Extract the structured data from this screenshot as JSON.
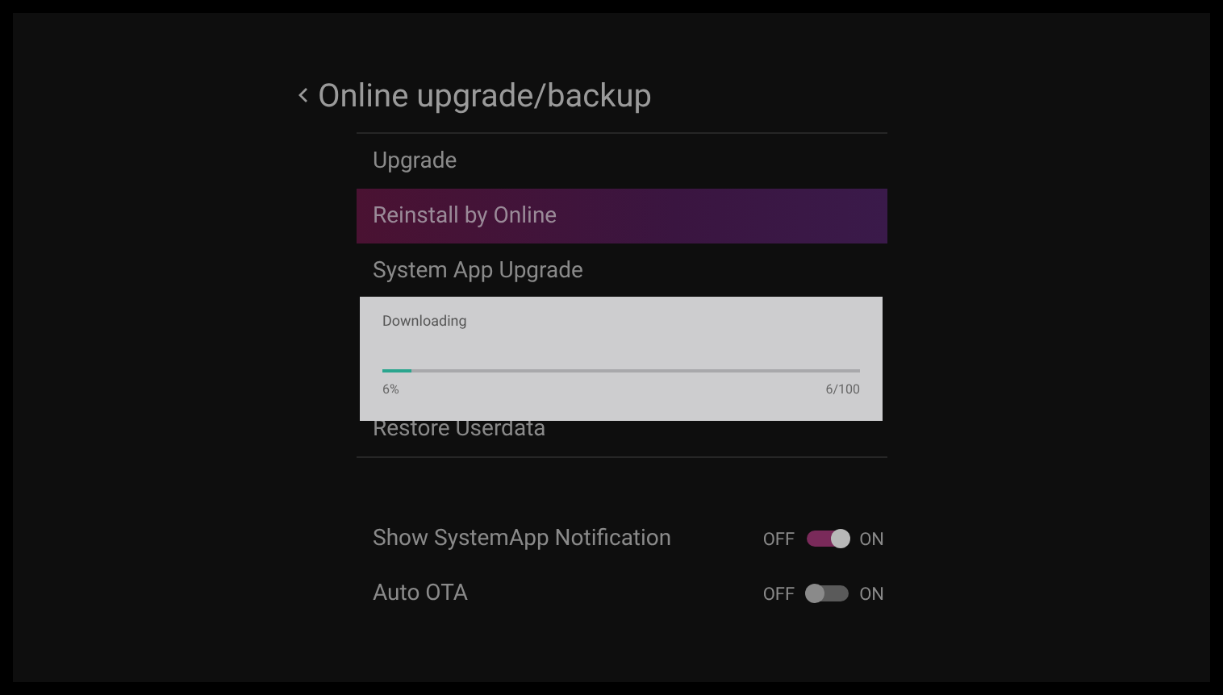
{
  "title": "Online upgrade/backup",
  "menu_items": [
    {
      "label": "Upgrade",
      "selected": false
    },
    {
      "label": "Reinstall by Online",
      "selected": true
    },
    {
      "label": "System App Upgrade",
      "selected": false
    }
  ],
  "menu_items_below_dialog": [
    {
      "label": "Restore Userdata",
      "selected": false
    }
  ],
  "dialog": {
    "title": "Downloading",
    "level": 0.06,
    "percent": "6%",
    "count": "6/100"
  },
  "toggles": [
    {
      "label": "Show SystemApp Notification",
      "off_label": "OFF",
      "on_label": "ON",
      "on": true
    },
    {
      "label": "Auto OTA",
      "off_label": "OFF",
      "on_label": "ON",
      "on": false
    }
  ]
}
